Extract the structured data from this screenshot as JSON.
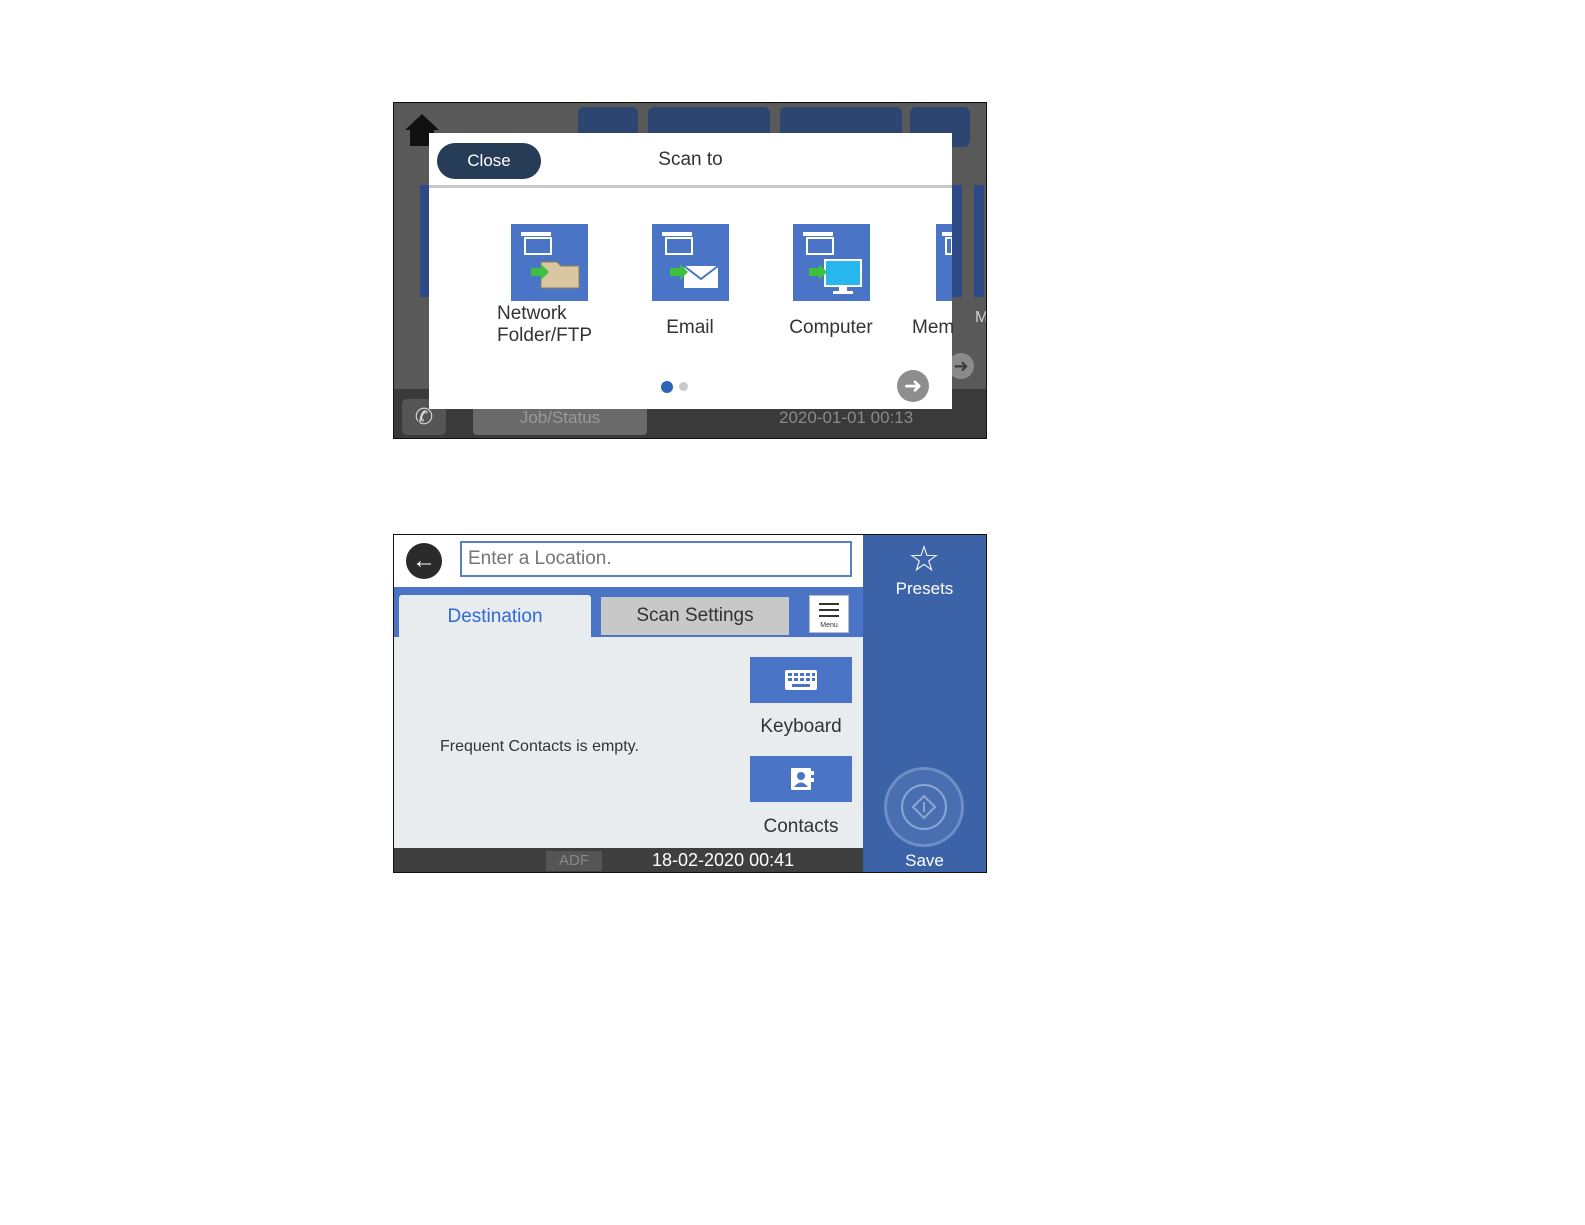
{
  "screen1": {
    "background": {
      "job_status_label": "Job/Status",
      "datetime": "2020-01-01 00:13",
      "partial_label": "M"
    },
    "dialog": {
      "close_label": "Close",
      "title": "Scan to",
      "items": [
        {
          "label": "Network\nFolder/FTP",
          "icon": "network-folder-icon"
        },
        {
          "label": "Email",
          "icon": "email-icon"
        },
        {
          "label": "Computer",
          "icon": "computer-icon"
        },
        {
          "label": "Mem",
          "icon": "memory-device-icon"
        }
      ],
      "page_indicator": {
        "current": 1,
        "total": 2
      }
    }
  },
  "screen2": {
    "location_input": {
      "placeholder": "Enter a Location."
    },
    "tabs": [
      {
        "label": "Destination",
        "selected": true
      },
      {
        "label": "Scan Settings",
        "selected": false
      }
    ],
    "menu_label": "Menu",
    "empty_message": "Frequent Contacts is empty.",
    "keyboard_label": "Keyboard",
    "contacts_label": "Contacts",
    "source_badge": "ADF",
    "datetime": "18-02-2020 00:41",
    "sidebar": {
      "presets_label": "Presets",
      "save_label": "Save"
    }
  },
  "colors": {
    "accent_blue": "#4a74c6",
    "sidebar_blue": "#3c63a8",
    "close_button": "#273c57",
    "tab_text_selected": "#2f6ad6"
  }
}
